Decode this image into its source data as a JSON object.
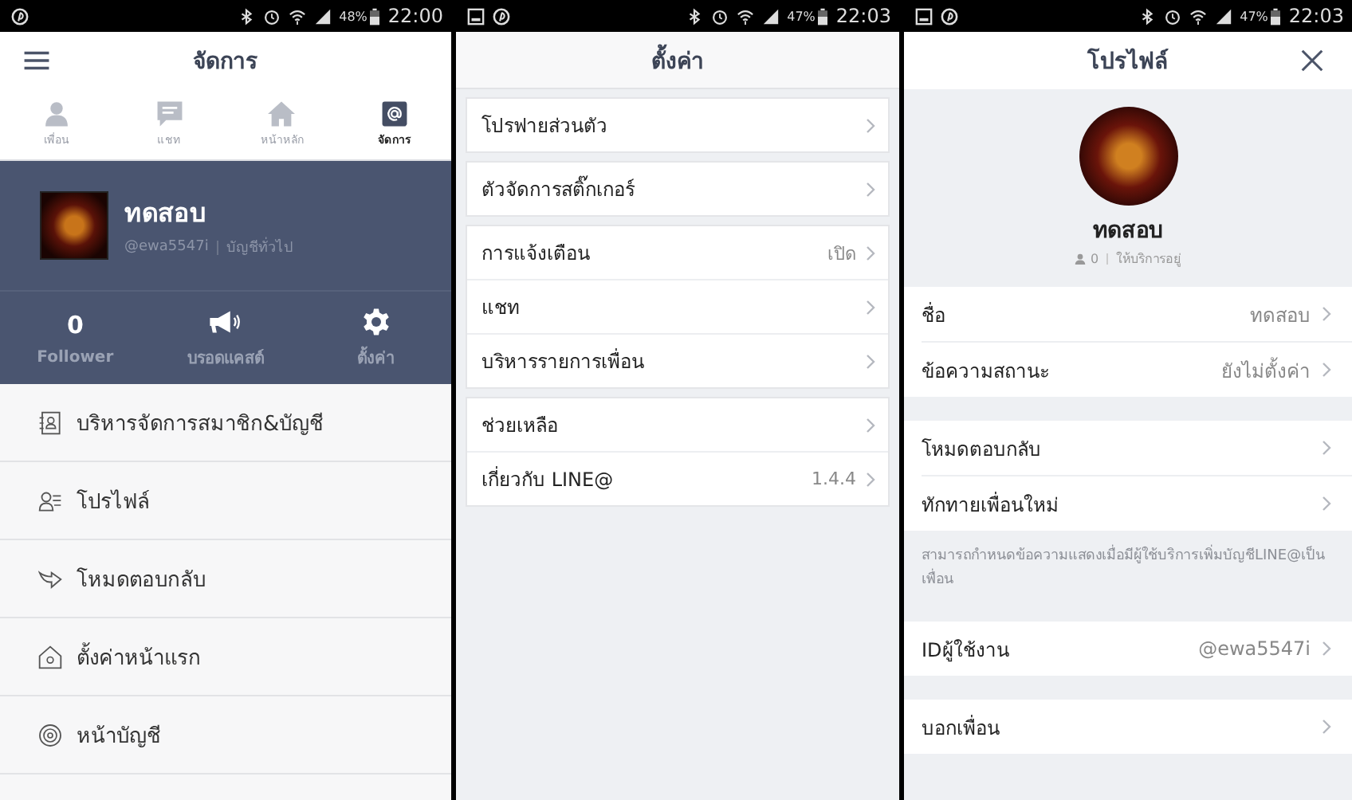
{
  "manage_screen": {
    "status_bar": {
      "battery": "48%",
      "time": "22:00"
    },
    "title": "จัดการ",
    "tabs": [
      {
        "kind": "friends",
        "label": "เพื่อน",
        "selected": false
      },
      {
        "kind": "chat",
        "label": "แชท",
        "selected": false
      },
      {
        "kind": "home",
        "label": "หน้าหลัก",
        "selected": false
      },
      {
        "kind": "manage",
        "label": "จัดการ",
        "selected": true
      }
    ],
    "account": {
      "name": "ทดสอบ",
      "id": "@ewa5547i",
      "type": "บัญชีทั่วไป"
    },
    "stats": [
      {
        "kind": "count",
        "value": "0",
        "label": "Follower"
      },
      {
        "kind": "broadcast",
        "label": "บรอดแคสต์"
      },
      {
        "kind": "settings",
        "label": "ตั้งค่า"
      }
    ],
    "menu": [
      {
        "kind": "members",
        "label": "บริหารจัดการสมาชิก&บัญชี"
      },
      {
        "kind": "profile",
        "label": "โปรไฟล์"
      },
      {
        "kind": "reply",
        "label": "โหมดตอบกลับ"
      },
      {
        "kind": "home",
        "label": "ตั้งค่าหน้าแรก"
      },
      {
        "kind": "account",
        "label": "หน้าบัญชี"
      }
    ]
  },
  "settings_screen": {
    "status_bar": {
      "battery": "47%",
      "time": "22:03"
    },
    "title": "ตั้งค่า",
    "groups": [
      {
        "items": [
          {
            "label": "โปรฟายส่วนตัว"
          }
        ]
      },
      {
        "items": [
          {
            "label": "ตัวจัดการสติ๊กเกอร์"
          }
        ]
      },
      {
        "items": [
          {
            "label": "การแจ้งเตือน",
            "value": "เปิด"
          },
          {
            "label": "แชท"
          },
          {
            "label": "บริหารรายการเพื่อน"
          }
        ]
      },
      {
        "items": [
          {
            "label": "ช่วยเหลือ"
          },
          {
            "label": "เกี่ยวกับ LINE@",
            "value": "1.4.4"
          }
        ]
      }
    ]
  },
  "profile_screen": {
    "status_bar": {
      "battery": "47%",
      "time": "22:03"
    },
    "title": "โปรไฟล์",
    "profile": {
      "name": "ทดสอบ",
      "followers": "0",
      "status": "ให้บริการอยู่"
    },
    "groups": [
      {
        "items": [
          {
            "label": "ชื่อ",
            "value": "ทดสอบ"
          },
          {
            "label": "ข้อความสถานะ",
            "value": "ยังไม่ตั้งค่า"
          }
        ]
      },
      {
        "items": [
          {
            "label": "โหมดตอบกลับ"
          },
          {
            "label": "ทักทายเพื่อนใหม่"
          }
        ],
        "note": "สามารถกำหนดข้อความแสดงเมื่อมีผู้ใช้บริการเพิ่มบัญชีLINE@เป็นเพื่อน"
      },
      {
        "items": [
          {
            "label": "IDผู้ใช้งาน",
            "value": "@ewa5547i"
          }
        ]
      },
      {
        "items": [
          {
            "label": "บอกเพื่อน"
          }
        ]
      }
    ]
  }
}
